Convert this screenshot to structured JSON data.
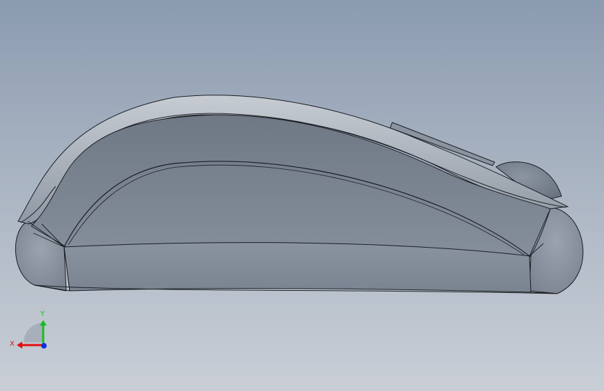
{
  "viewport": {
    "background_top": "#8b9bb0",
    "background_bottom": "#c9ced6"
  },
  "model": {
    "part": "mouse-shell-side-view",
    "fill_color": "#7d8795",
    "edge_color": "#1a1d22"
  },
  "triad": {
    "x_label": "X",
    "y_label": "Y",
    "x_color": "#e01010",
    "y_color": "#10c020",
    "z_color": "#1030e0"
  }
}
